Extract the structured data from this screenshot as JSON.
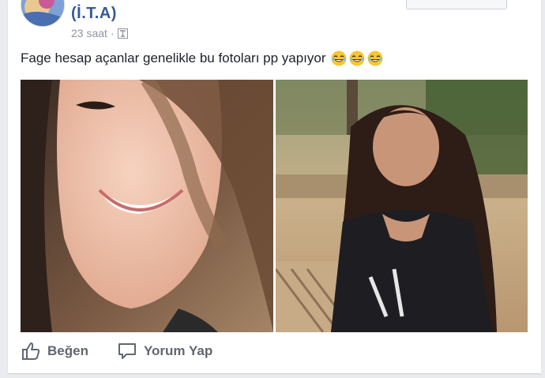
{
  "post": {
    "author": "(İ.T.A)",
    "time": "23 saat",
    "separator": "·",
    "audience_icon": "globe-icon",
    "text": "Fage hesap açanlar genelikle bu fotoları pp yapıyor",
    "emojis": [
      "joy-emoji",
      "joy-emoji",
      "joy-emoji"
    ],
    "photos": [
      {
        "name": "photo-smiling-girl-closeup"
      },
      {
        "name": "photo-girl-outdoor"
      }
    ]
  },
  "actions": {
    "like_label": "Beğen",
    "like_icon": "thumbs-up-icon",
    "comment_label": "Yorum Yap",
    "comment_icon": "comment-bubble-icon"
  },
  "colors": {
    "author": "#365899",
    "meta": "#90949c",
    "text": "#1d2129",
    "action": "#616770",
    "background": "#e9ebee"
  }
}
